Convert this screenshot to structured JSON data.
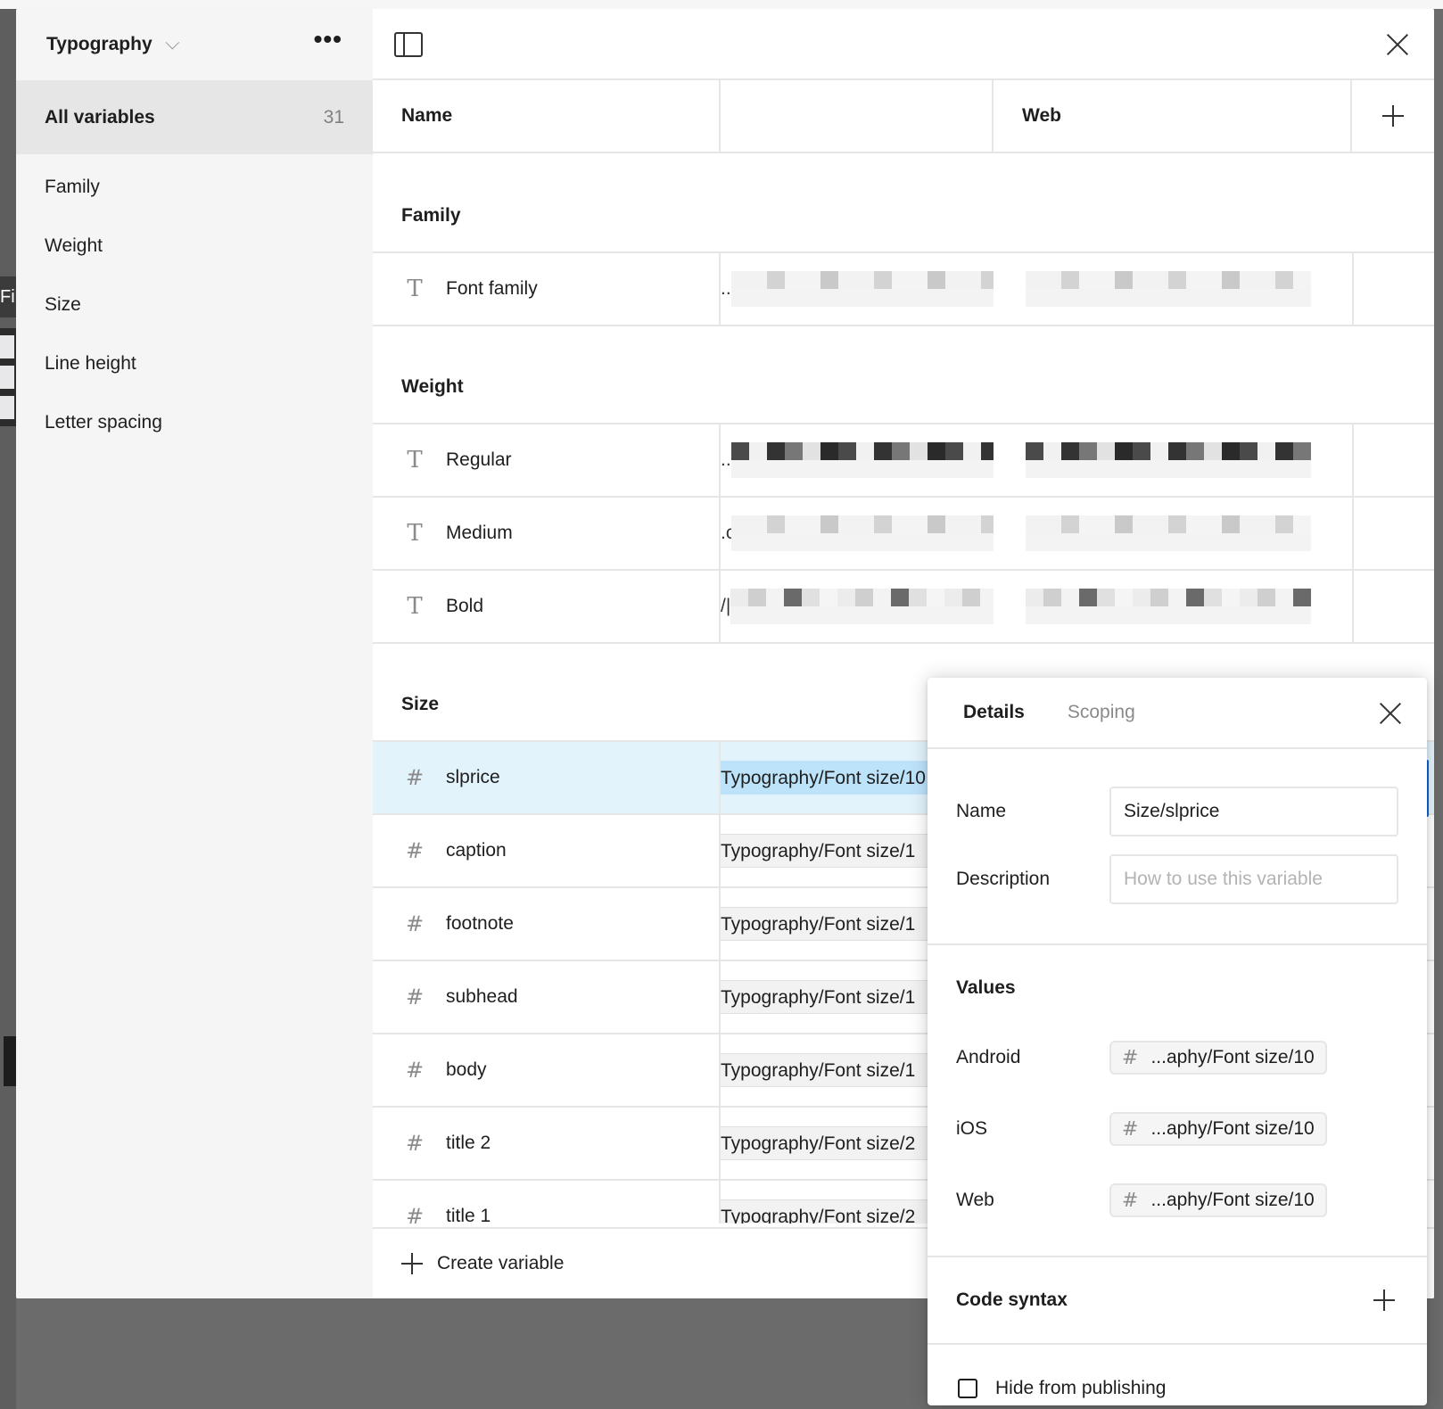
{
  "sidebar": {
    "collection_title": "Typography",
    "all_variables": {
      "label": "All variables",
      "count": "31"
    },
    "groups": [
      "Family",
      "Weight",
      "Size",
      "Line height",
      "Letter spacing"
    ]
  },
  "canvas_edge": {
    "fill_label": "Fill"
  },
  "table": {
    "headers": {
      "name": "Name",
      "mode1": "",
      "mode2": "Web"
    },
    "groups": [
      {
        "title": "Family",
        "rows": [
          {
            "name": "Font family",
            "type": "string",
            "icon": "text-type-icon",
            "value": "[redacted]",
            "web": "[redacted]"
          }
        ]
      },
      {
        "title": "Weight",
        "rows": [
          {
            "name": "Regular",
            "type": "string",
            "icon": "text-type-icon",
            "value": "[redacted]",
            "web": "[redacted]"
          },
          {
            "name": "Medium",
            "type": "string",
            "icon": "text-type-icon",
            "value": "[redacted]",
            "web": "[redacted]"
          },
          {
            "name": "Bold",
            "type": "string",
            "icon": "text-type-icon",
            "value": "[redacted]",
            "web": "[redacted]"
          }
        ]
      },
      {
        "title": "Size",
        "rows": [
          {
            "name": "slprice",
            "type": "number",
            "icon": "number-type-icon",
            "value": "Typography/Font size/10",
            "selected": true
          },
          {
            "name": "caption",
            "type": "number",
            "icon": "number-type-icon",
            "value": "Typography/Font size/1"
          },
          {
            "name": "footnote",
            "type": "number",
            "icon": "number-type-icon",
            "value": "Typography/Font size/1"
          },
          {
            "name": "subhead",
            "type": "number",
            "icon": "number-type-icon",
            "value": "Typography/Font size/1"
          },
          {
            "name": "body",
            "type": "number",
            "icon": "number-type-icon",
            "value": "Typography/Font size/1"
          },
          {
            "name": "title 2",
            "type": "number",
            "icon": "number-type-icon",
            "value": "Typography/Font size/2"
          },
          {
            "name": "title 1",
            "type": "number",
            "icon": "number-type-icon",
            "value": "Typography/Font size/2"
          }
        ]
      }
    ],
    "create_label": "Create variable"
  },
  "details": {
    "tabs": [
      "Details",
      "Scoping"
    ],
    "active_tab": "Details",
    "name_label": "Name",
    "name_value": "Size/slprice",
    "description_label": "Description",
    "description_placeholder": "How to use this variable",
    "values_title": "Values",
    "values": [
      {
        "mode": "Android",
        "value": "...aphy/Font size/10"
      },
      {
        "mode": "iOS",
        "value": "...aphy/Font size/10"
      },
      {
        "mode": "Web",
        "value": "...aphy/Font size/10"
      }
    ],
    "code_syntax_label": "Code syntax",
    "hide_from_publishing_label": "Hide from publishing",
    "hide_from_publishing_checked": false
  },
  "colors": {
    "selection_row": "#e3f3fc",
    "selection_alias": "#bde3fa",
    "accent": "#0d66d0"
  }
}
